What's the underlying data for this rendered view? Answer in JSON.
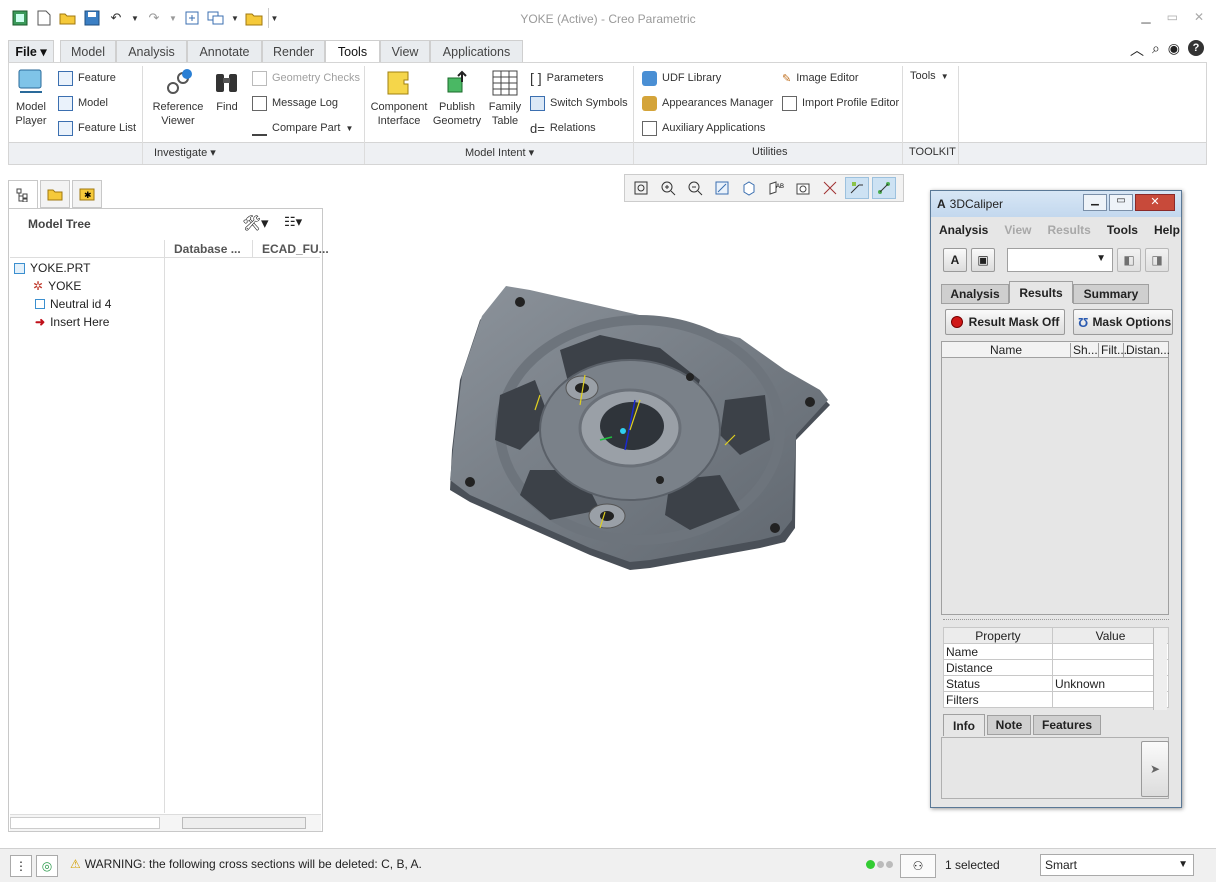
{
  "window": {
    "title": "YOKE (Active) - Creo Parametric"
  },
  "tabs": [
    "File",
    "Model",
    "Analysis",
    "Annotate",
    "Render",
    "Tools",
    "View",
    "Applications"
  ],
  "active_tab": "Tools",
  "ribbon": {
    "model_player": "Model\nPlayer",
    "feature": "Feature",
    "model": "Model",
    "feature_list": "Feature List",
    "reference_viewer": "Reference\nViewer",
    "find": "Find",
    "geometry_checks": "Geometry Checks",
    "message_log": "Message Log",
    "compare_part": "Compare Part",
    "component_interface": "Component\nInterface",
    "publish_geometry": "Publish\nGeometry",
    "family_table": "Family\nTable",
    "parameters": "Parameters",
    "switch_symbols": "Switch Symbols",
    "relations": "Relations",
    "udf_library": "UDF Library",
    "appearances_manager": "Appearances Manager",
    "auxiliary_applications": "Auxiliary Applications",
    "image_editor": "Image Editor",
    "import_profile_editor": "Import Profile Editor",
    "tools": "Tools",
    "groups": {
      "investigate": "Investigate",
      "model_intent": "Model Intent",
      "utilities": "Utilities",
      "toolkit": "TOOLKIT"
    }
  },
  "model_tree": {
    "title": "Model Tree",
    "columns": [
      "Database ...",
      "ECAD_FU..."
    ],
    "items": [
      "YOKE.PRT",
      "YOKE",
      "Neutral id 4",
      "Insert Here"
    ]
  },
  "dialog": {
    "title": "3DCaliper",
    "menu": [
      "Analysis",
      "View",
      "Results",
      "Tools",
      "Help"
    ],
    "tabs": [
      "Analysis",
      "Results",
      "Summary"
    ],
    "result_mask": "Result Mask Off",
    "mask_options": "Mask Options",
    "list_columns": [
      "Name",
      "Sh...",
      "Filt...",
      "Distan..."
    ],
    "prop_headers": [
      "Property",
      "Value"
    ],
    "props": [
      {
        "name": "Name",
        "value": ""
      },
      {
        "name": "Distance",
        "value": ""
      },
      {
        "name": "Status",
        "value": "Unknown"
      },
      {
        "name": "Filters",
        "value": ""
      }
    ],
    "bottom_tabs": [
      "Info",
      "Note",
      "Features"
    ]
  },
  "status": {
    "message": "WARNING: the following cross sections will be deleted: C, B, A.",
    "selected": "1 selected",
    "filter": "Smart"
  }
}
